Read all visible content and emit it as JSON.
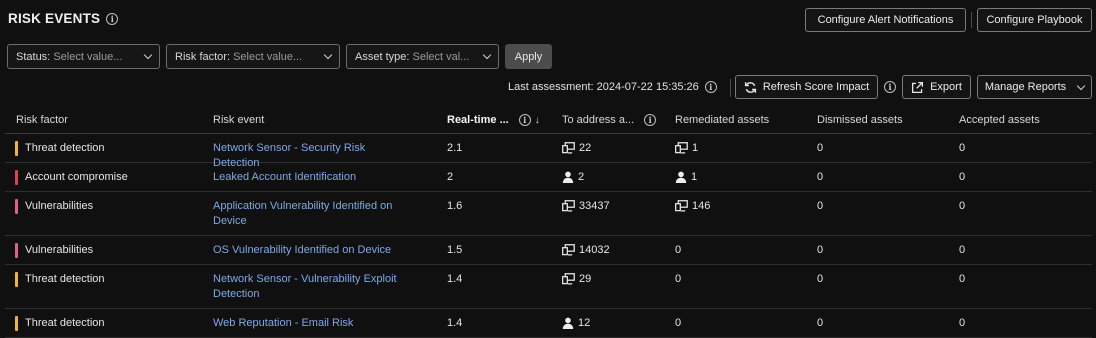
{
  "header": {
    "title": "RISK EVENTS"
  },
  "toolbar": {
    "configure_alert": "Configure Alert Notifications",
    "configure_playbook": "Configure Playbook"
  },
  "filters": {
    "status": {
      "label": "Status:",
      "placeholder": "Select value..."
    },
    "risk_factor": {
      "label": "Risk factor:",
      "placeholder": "Select value..."
    },
    "asset_type": {
      "label": "Asset type:",
      "placeholder": "Select val..."
    },
    "apply": "Apply"
  },
  "assessment": {
    "text": "Last assessment: 2024-07-22 15:35:26",
    "refresh": "Refresh Score Impact",
    "export": "Export",
    "manage": "Manage Reports"
  },
  "table": {
    "columns": {
      "risk_factor": "Risk factor",
      "risk_event": "Risk event",
      "realtime": "Real-time ...",
      "to_address": "To address a...",
      "remediated": "Remediated assets",
      "dismissed": "Dismissed assets",
      "accepted": "Accepted assets"
    },
    "rows": [
      {
        "factor": "Threat detection",
        "color": "#f0b43a",
        "event": "Network Sensor - Security Risk Detection",
        "score": "2.1",
        "to_address": "22",
        "to_icon": "device",
        "remediated": "1",
        "rem_icon": "device",
        "dismissed": "0",
        "accepted": "0"
      },
      {
        "factor": "Account compromise",
        "color": "#e0434f",
        "event": "Leaked Account Identification",
        "score": "2",
        "to_address": "2",
        "to_icon": "user",
        "remediated": "1",
        "rem_icon": "user",
        "dismissed": "0",
        "accepted": "0"
      },
      {
        "factor": "Vulnerabilities",
        "color": "#e0608a",
        "event": "Application Vulnerability Identified on Device",
        "score": "1.6",
        "to_address": "33437",
        "to_icon": "device",
        "remediated": "146",
        "rem_icon": "device",
        "dismissed": "0",
        "accepted": "0"
      },
      {
        "factor": "Vulnerabilities",
        "color": "#e0608a",
        "event": "OS Vulnerability Identified on Device",
        "score": "1.5",
        "to_address": "14032",
        "to_icon": "device",
        "remediated": "0",
        "rem_icon": "",
        "dismissed": "0",
        "accepted": "0"
      },
      {
        "factor": "Threat detection",
        "color": "#f0b43a",
        "event": "Network Sensor - Vulnerability Exploit Detection",
        "score": "1.4",
        "to_address": "29",
        "to_icon": "device",
        "remediated": "0",
        "rem_icon": "",
        "dismissed": "0",
        "accepted": "0"
      },
      {
        "factor": "Threat detection",
        "color": "#f0b43a",
        "event": "Web Reputation - Email Risk",
        "score": "1.4",
        "to_address": "12",
        "to_icon": "user",
        "remediated": "0",
        "rem_icon": "",
        "dismissed": "0",
        "accepted": "0"
      }
    ]
  }
}
